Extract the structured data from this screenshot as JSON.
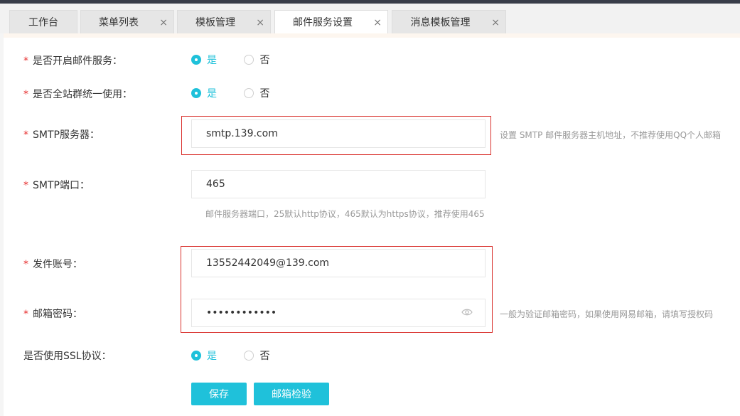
{
  "tabs": [
    {
      "label": "工作台"
    },
    {
      "label": "菜单列表",
      "close": "×"
    },
    {
      "label": "模板管理",
      "close": "×"
    },
    {
      "label": "邮件服务设置",
      "close": "×"
    },
    {
      "label": "消息模板管理",
      "close": "×"
    }
  ],
  "form": {
    "required_mark": "*",
    "enable_mail": {
      "label": "是否开启邮件服务：",
      "yes": "是",
      "no": "否"
    },
    "global_use": {
      "label": "是否全站群统一使用：",
      "yes": "是",
      "no": "否"
    },
    "smtp_server": {
      "label": "SMTP服务器：",
      "value": "smtp.139.com",
      "hint": "设置 SMTP 邮件服务器主机地址，不推荐使用QQ个人邮箱"
    },
    "smtp_port": {
      "label": "SMTP端口：",
      "value": "465",
      "hint": "邮件服务器端口，25默认http协议，465默认为https协议，推荐使用465"
    },
    "sender_account": {
      "label": "发件账号：",
      "value": "13552442049@139.com"
    },
    "mail_password": {
      "label": "邮箱密码：",
      "value": "••••••••••••",
      "hint": "一般为验证邮箱密码，如果使用网易邮箱，请填写授权码"
    },
    "use_ssl": {
      "label": "是否使用SSL协议：",
      "yes": "是",
      "no": "否"
    }
  },
  "buttons": {
    "save": "保存",
    "verify": "邮箱检验"
  },
  "colors": {
    "accent": "#1fc1da",
    "required": "#e62d2d",
    "highlight_box": "#d9302c"
  }
}
